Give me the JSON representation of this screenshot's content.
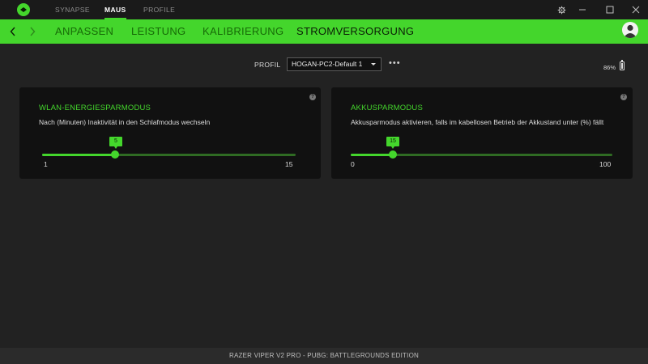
{
  "window": {
    "top_tabs": [
      {
        "label": "SYNAPSE",
        "active": false
      },
      {
        "label": "MAUS",
        "active": true
      },
      {
        "label": "PROFILE",
        "active": false
      }
    ]
  },
  "nav": {
    "tabs": [
      {
        "label": "ANPASSEN",
        "active": false
      },
      {
        "label": "LEISTUNG",
        "active": false
      },
      {
        "label": "KALIBRIERUNG",
        "active": false
      },
      {
        "label": "STROMVERSORGUNG",
        "active": true
      }
    ]
  },
  "profile": {
    "label": "PROFIL",
    "selected": "HOGAN-PC2-Default 1",
    "more": "•••"
  },
  "battery": {
    "text": "86%",
    "level": 0.86
  },
  "cards": {
    "wlan": {
      "help": "?",
      "title": "WLAN-ENERGIESPARMODUS",
      "description": "Nach (Minuten) Inaktivität in den Schlafmodus wechseln",
      "value": "5",
      "min": "1",
      "max": "15"
    },
    "akku": {
      "help": "?",
      "title": "AKKUSPARMODUS",
      "description": "Akkusparmodus aktivieren, falls im kabellosen Betrieb der Akkustand unter (%) fällt",
      "value": "15",
      "min": "0",
      "max": "100"
    }
  },
  "footer": {
    "device": "RAZER VIPER V2 PRO - PUBG: BATTLEGROUNDS EDITION"
  },
  "colors": {
    "accent": "#44d62c",
    "background": "#222222",
    "card": "#111111"
  }
}
